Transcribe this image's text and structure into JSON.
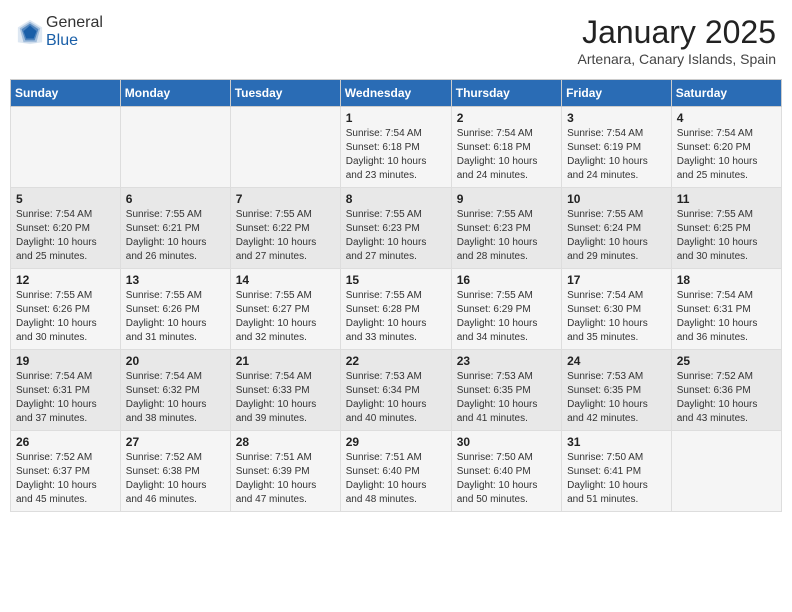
{
  "logo": {
    "general": "General",
    "blue": "Blue"
  },
  "header": {
    "month": "January 2025",
    "location": "Artenara, Canary Islands, Spain"
  },
  "weekdays": [
    "Sunday",
    "Monday",
    "Tuesday",
    "Wednesday",
    "Thursday",
    "Friday",
    "Saturday"
  ],
  "weeks": [
    [
      {
        "day": "",
        "info": ""
      },
      {
        "day": "",
        "info": ""
      },
      {
        "day": "",
        "info": ""
      },
      {
        "day": "1",
        "info": "Sunrise: 7:54 AM\nSunset: 6:18 PM\nDaylight: 10 hours\nand 23 minutes."
      },
      {
        "day": "2",
        "info": "Sunrise: 7:54 AM\nSunset: 6:18 PM\nDaylight: 10 hours\nand 24 minutes."
      },
      {
        "day": "3",
        "info": "Sunrise: 7:54 AM\nSunset: 6:19 PM\nDaylight: 10 hours\nand 24 minutes."
      },
      {
        "day": "4",
        "info": "Sunrise: 7:54 AM\nSunset: 6:20 PM\nDaylight: 10 hours\nand 25 minutes."
      }
    ],
    [
      {
        "day": "5",
        "info": "Sunrise: 7:54 AM\nSunset: 6:20 PM\nDaylight: 10 hours\nand 25 minutes."
      },
      {
        "day": "6",
        "info": "Sunrise: 7:55 AM\nSunset: 6:21 PM\nDaylight: 10 hours\nand 26 minutes."
      },
      {
        "day": "7",
        "info": "Sunrise: 7:55 AM\nSunset: 6:22 PM\nDaylight: 10 hours\nand 27 minutes."
      },
      {
        "day": "8",
        "info": "Sunrise: 7:55 AM\nSunset: 6:23 PM\nDaylight: 10 hours\nand 27 minutes."
      },
      {
        "day": "9",
        "info": "Sunrise: 7:55 AM\nSunset: 6:23 PM\nDaylight: 10 hours\nand 28 minutes."
      },
      {
        "day": "10",
        "info": "Sunrise: 7:55 AM\nSunset: 6:24 PM\nDaylight: 10 hours\nand 29 minutes."
      },
      {
        "day": "11",
        "info": "Sunrise: 7:55 AM\nSunset: 6:25 PM\nDaylight: 10 hours\nand 30 minutes."
      }
    ],
    [
      {
        "day": "12",
        "info": "Sunrise: 7:55 AM\nSunset: 6:26 PM\nDaylight: 10 hours\nand 30 minutes."
      },
      {
        "day": "13",
        "info": "Sunrise: 7:55 AM\nSunset: 6:26 PM\nDaylight: 10 hours\nand 31 minutes."
      },
      {
        "day": "14",
        "info": "Sunrise: 7:55 AM\nSunset: 6:27 PM\nDaylight: 10 hours\nand 32 minutes."
      },
      {
        "day": "15",
        "info": "Sunrise: 7:55 AM\nSunset: 6:28 PM\nDaylight: 10 hours\nand 33 minutes."
      },
      {
        "day": "16",
        "info": "Sunrise: 7:55 AM\nSunset: 6:29 PM\nDaylight: 10 hours\nand 34 minutes."
      },
      {
        "day": "17",
        "info": "Sunrise: 7:54 AM\nSunset: 6:30 PM\nDaylight: 10 hours\nand 35 minutes."
      },
      {
        "day": "18",
        "info": "Sunrise: 7:54 AM\nSunset: 6:31 PM\nDaylight: 10 hours\nand 36 minutes."
      }
    ],
    [
      {
        "day": "19",
        "info": "Sunrise: 7:54 AM\nSunset: 6:31 PM\nDaylight: 10 hours\nand 37 minutes."
      },
      {
        "day": "20",
        "info": "Sunrise: 7:54 AM\nSunset: 6:32 PM\nDaylight: 10 hours\nand 38 minutes."
      },
      {
        "day": "21",
        "info": "Sunrise: 7:54 AM\nSunset: 6:33 PM\nDaylight: 10 hours\nand 39 minutes."
      },
      {
        "day": "22",
        "info": "Sunrise: 7:53 AM\nSunset: 6:34 PM\nDaylight: 10 hours\nand 40 minutes."
      },
      {
        "day": "23",
        "info": "Sunrise: 7:53 AM\nSunset: 6:35 PM\nDaylight: 10 hours\nand 41 minutes."
      },
      {
        "day": "24",
        "info": "Sunrise: 7:53 AM\nSunset: 6:35 PM\nDaylight: 10 hours\nand 42 minutes."
      },
      {
        "day": "25",
        "info": "Sunrise: 7:52 AM\nSunset: 6:36 PM\nDaylight: 10 hours\nand 43 minutes."
      }
    ],
    [
      {
        "day": "26",
        "info": "Sunrise: 7:52 AM\nSunset: 6:37 PM\nDaylight: 10 hours\nand 45 minutes."
      },
      {
        "day": "27",
        "info": "Sunrise: 7:52 AM\nSunset: 6:38 PM\nDaylight: 10 hours\nand 46 minutes."
      },
      {
        "day": "28",
        "info": "Sunrise: 7:51 AM\nSunset: 6:39 PM\nDaylight: 10 hours\nand 47 minutes."
      },
      {
        "day": "29",
        "info": "Sunrise: 7:51 AM\nSunset: 6:40 PM\nDaylight: 10 hours\nand 48 minutes."
      },
      {
        "day": "30",
        "info": "Sunrise: 7:50 AM\nSunset: 6:40 PM\nDaylight: 10 hours\nand 50 minutes."
      },
      {
        "day": "31",
        "info": "Sunrise: 7:50 AM\nSunset: 6:41 PM\nDaylight: 10 hours\nand 51 minutes."
      },
      {
        "day": "",
        "info": ""
      }
    ]
  ]
}
